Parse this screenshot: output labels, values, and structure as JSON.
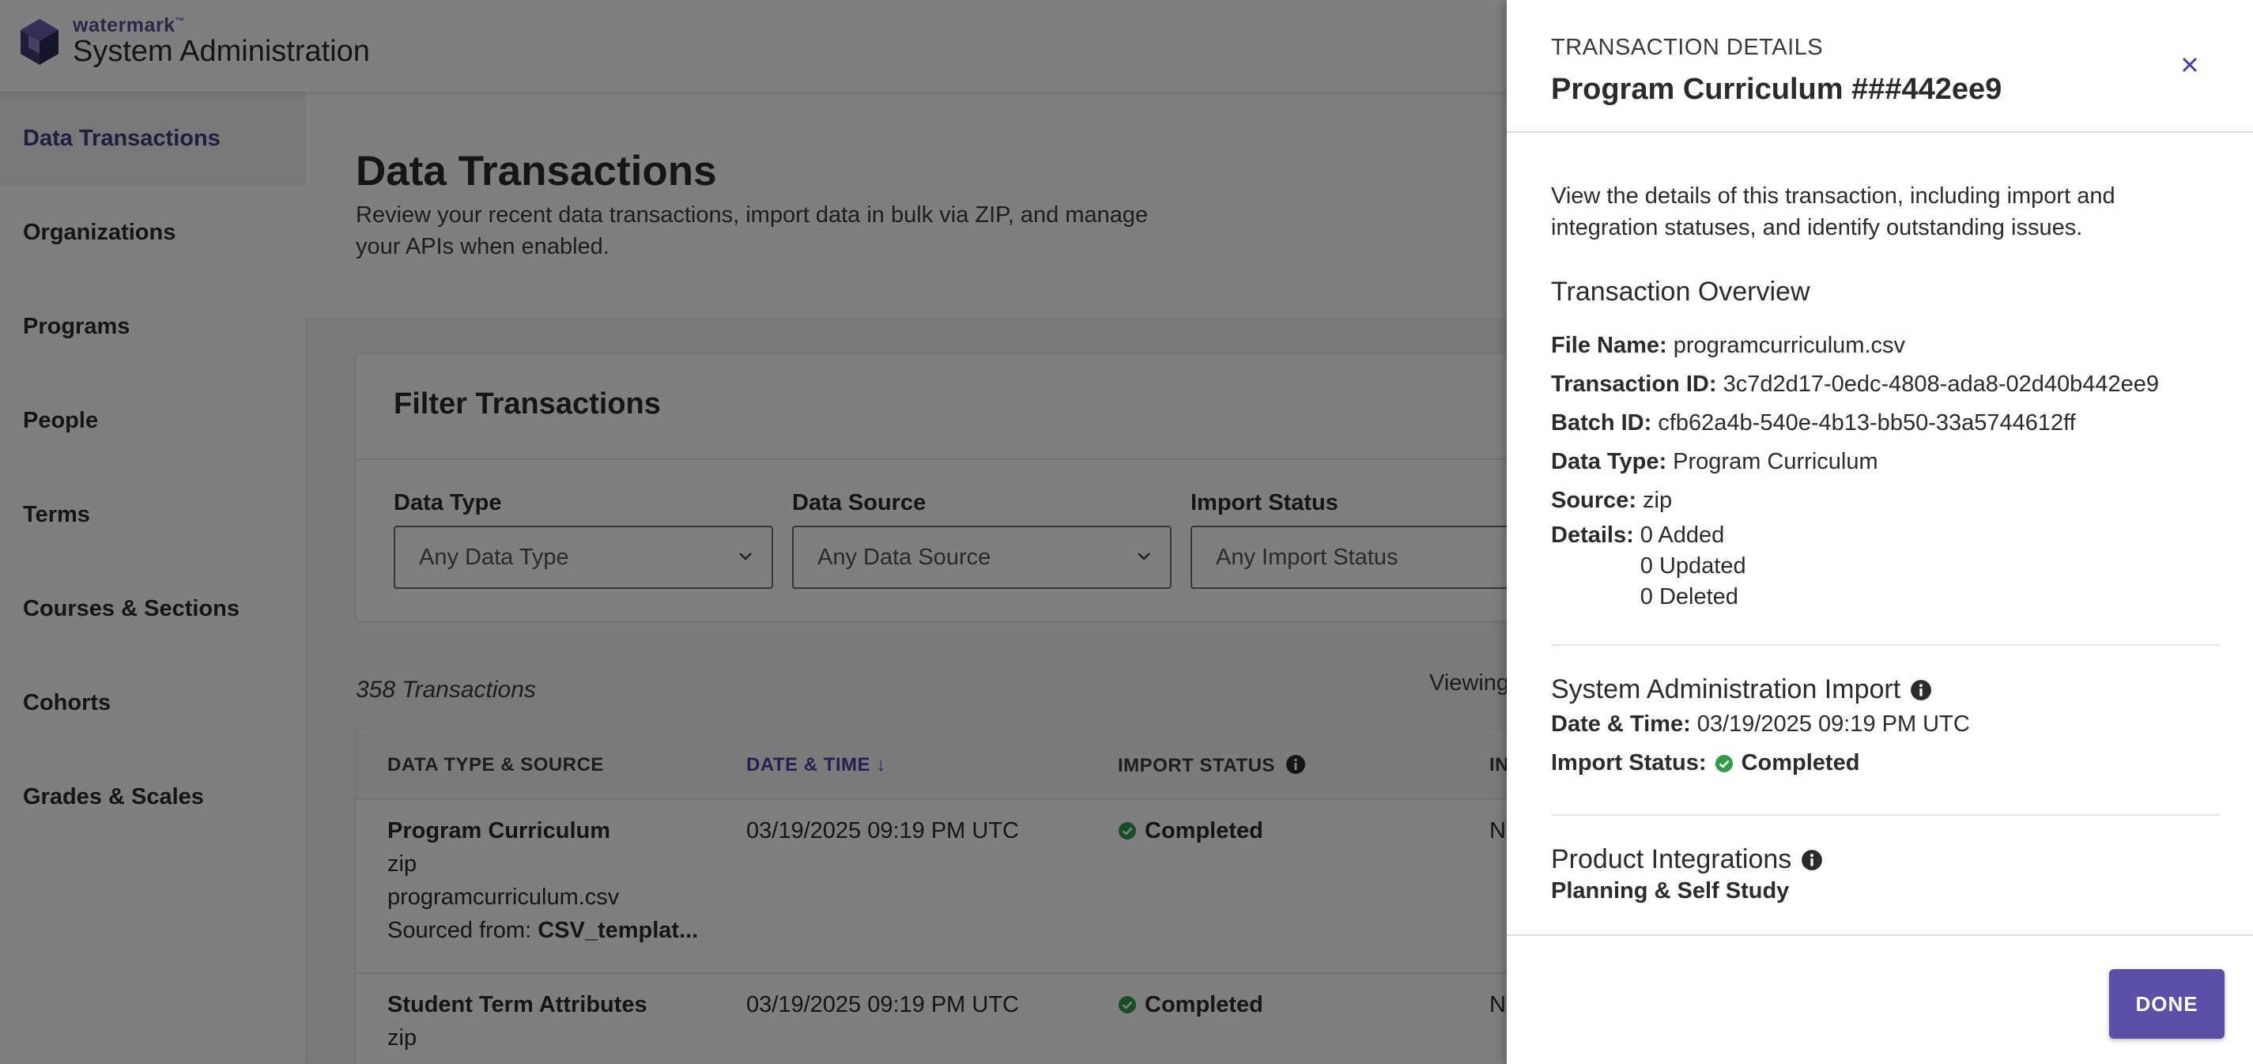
{
  "app": {
    "brand_small": "watermark",
    "brand_tm": "™",
    "title": "System Administration"
  },
  "sidebar": {
    "items": [
      {
        "label": "Data Transactions",
        "active": true
      },
      {
        "label": "Organizations"
      },
      {
        "label": "Programs"
      },
      {
        "label": "People"
      },
      {
        "label": "Terms"
      },
      {
        "label": "Courses & Sections"
      },
      {
        "label": "Cohorts"
      },
      {
        "label": "Grades & Scales"
      }
    ]
  },
  "page": {
    "title": "Data Transactions",
    "description": "Review your recent data transactions, import data in bulk via ZIP, and manage your APIs when enabled."
  },
  "filters": {
    "title": "Filter Transactions",
    "data_type": {
      "label": "Data Type",
      "value": "Any Data Type"
    },
    "data_source": {
      "label": "Data Source",
      "value": "Any Data Source"
    },
    "import_status": {
      "label": "Import Status",
      "value": "Any Import Status"
    }
  },
  "transactions": {
    "count": "358 Transactions",
    "viewing": "Viewing",
    "columns": {
      "data_type_source": "DATA TYPE & SOURCE",
      "date_time": "DATE & TIME",
      "sort_indicator": "↓",
      "import_status": "IMPORT STATUS",
      "integration_partial": "IN"
    },
    "rows": [
      {
        "name": "Program Curriculum",
        "source": "zip",
        "file": "programcurriculum.csv",
        "sourced_label": "Sourced from: ",
        "sourced_value": "CSV_templat...",
        "date": "03/19/2025 09:19 PM UTC",
        "status": "Completed",
        "integration_partial": "N"
      },
      {
        "name": "Student Term Attributes",
        "source": "zip",
        "date": "03/19/2025 09:19 PM UTC",
        "status": "Completed",
        "integration_partial": "N"
      }
    ]
  },
  "panel": {
    "kicker": "TRANSACTION DETAILS",
    "title": "Program Curriculum ###442ee9",
    "intro": "View the details of this transaction, including import and integration statuses, and identify outstanding issues.",
    "overview": {
      "title": "Transaction Overview",
      "file_name_label": "File Name:",
      "file_name": "programcurriculum.csv",
      "transaction_id_label": "Transaction ID:",
      "transaction_id": "3c7d2d17-0edc-4808-ada8-02d40b442ee9",
      "batch_id_label": "Batch ID:",
      "batch_id": "cfb62a4b-540e-4b13-bb50-33a5744612ff",
      "data_type_label": "Data Type:",
      "data_type": "Program Curriculum",
      "source_label": "Source:",
      "source": "zip",
      "details_label": "Details:",
      "details": [
        "0 Added",
        "0 Updated",
        "0 Deleted"
      ]
    },
    "import": {
      "title": "System Administration Import",
      "datetime_label": "Date & Time:",
      "datetime": "03/19/2025 09:19 PM UTC",
      "status_label": "Import Status:",
      "status": "Completed"
    },
    "integrations": {
      "title": "Product Integrations",
      "first": "Planning & Self Study"
    },
    "done_label": "DONE"
  },
  "colors": {
    "accent": "#5b4fa8",
    "success": "#2e9e4a",
    "overlay": "rgba(0,0,0,0.5)"
  }
}
